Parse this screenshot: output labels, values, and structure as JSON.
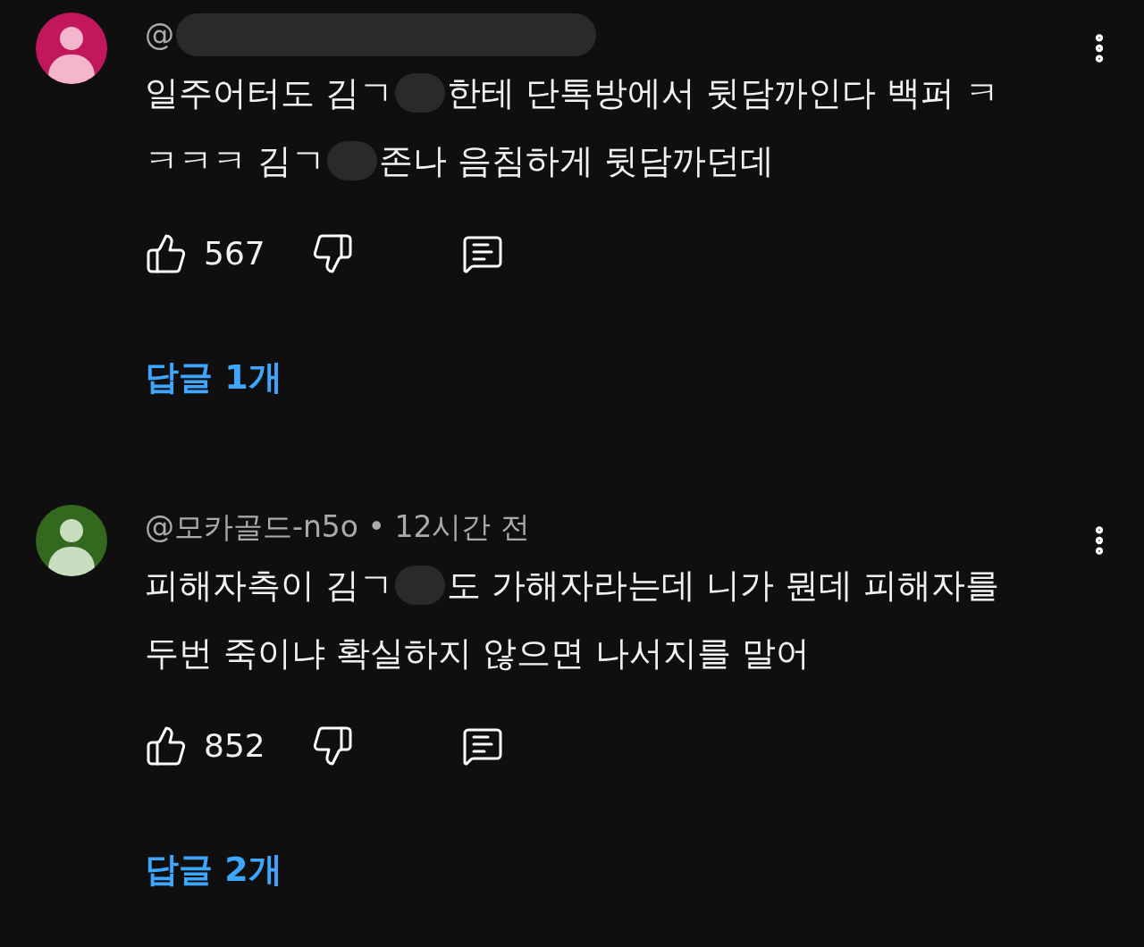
{
  "comments": [
    {
      "color": "#c2185b",
      "author": [
        {
          "kind": "text",
          "text": "@"
        },
        {
          "kind": "redaction"
        }
      ],
      "lines": [
        [
          {
            "kind": "text",
            "text": "일주어터도 김ㄱ"
          },
          {
            "kind": "redaction"
          },
          {
            "kind": "text",
            "text": "한테 단톡방에서 뒷담까인다 백퍼 ㅋ"
          }
        ],
        [
          {
            "kind": "text",
            "text": "ㅋㅋㅋ 김ㄱ"
          },
          {
            "kind": "redaction"
          },
          {
            "kind": "text",
            "text": "존나 음침하게 뒷담까던데"
          }
        ]
      ],
      "likes": "567",
      "replies": "답글 1개"
    },
    {
      "color": "#33691e",
      "author": [
        {
          "kind": "text",
          "text": "@모카골드-n5o • 12시간 전"
        }
      ],
      "lines": [
        [
          {
            "kind": "text",
            "text": "피해자측이 김ㄱ"
          },
          {
            "kind": "redaction"
          },
          {
            "kind": "text",
            "text": "도 가해자라는데 니가 뭔데 피해자를"
          }
        ],
        [
          {
            "kind": "text",
            "text": "두번 죽이냐 확실하지 않으면 나서지를 말어"
          }
        ]
      ],
      "likes": "852",
      "replies": "답글 2개"
    }
  ]
}
